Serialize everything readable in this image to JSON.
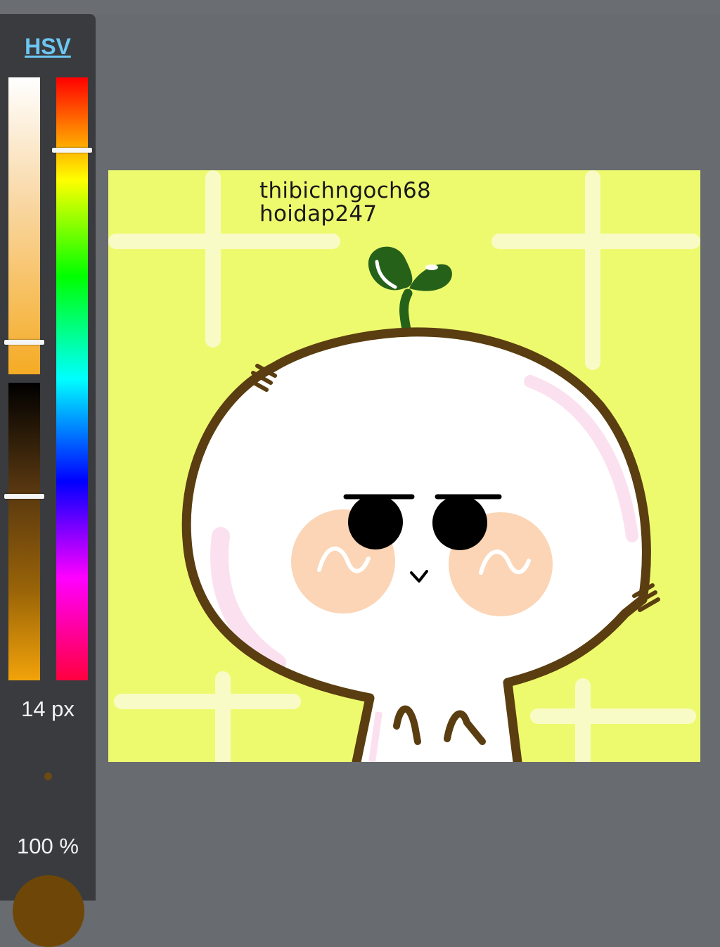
{
  "color_panel": {
    "mode_label": "HSV",
    "saturation_level": 0.89,
    "value_level": 0.38,
    "hue_level": 0.12,
    "brush_size": "14 px",
    "opacity": "100 %",
    "current_color": "#6e4708"
  },
  "canvas": {
    "background_color": "#eefa6e",
    "watermark_line1": "thibichngoch68",
    "watermark_line2": "hoidap247"
  }
}
